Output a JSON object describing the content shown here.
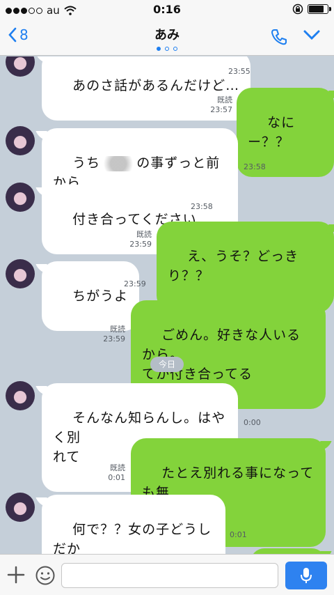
{
  "status": {
    "carrier": "au",
    "time": "0:16"
  },
  "nav": {
    "back_count": "8",
    "title": "あみ"
  },
  "chat": {
    "m1_text": "あのさ話があるんだけど…",
    "m1_time": "23:55",
    "m2_read": "既読",
    "m2_time": "23:57",
    "m2_text": "なにー？？",
    "m3_pre": "うち",
    "m3_post": "の事ずっと前から\n好きでした",
    "m3_time": "23:58",
    "m4_text": "付き合ってください",
    "m4_time": "23:58",
    "m5_read": "既読",
    "m5_time": "23:59",
    "m5_text": "え、うそ？どっきり？？",
    "m6_text": "ちがうよ",
    "m6_time": "23:59",
    "m7_read": "既読",
    "m7_time": "23:59",
    "m7_text": "ごめん。好きな人いるから。\nてか付き合ってる",
    "date_sep": "今日",
    "m8_text": "そんなん知らんし。はやく別\nれて",
    "m8_time": "0:00",
    "m9_read": "既読",
    "m9_time": "0:01",
    "m9_text": "たとえ別れる事になっても無\n理。ごめん",
    "m10_text": "何で？？女の子どうしだか\nら？？",
    "m10_time": "0:01"
  },
  "colors": {
    "accent": "#1e7ff0",
    "outgoing": "#83d33b",
    "background": "#c5cfd9"
  },
  "icons": [
    "signal-dots-icon",
    "wifi-icon",
    "lock-rotation-icon",
    "battery-icon",
    "back-chevron-icon",
    "phone-icon",
    "chevron-down-icon",
    "plus-icon",
    "emoji-icon",
    "microphone-icon"
  ]
}
